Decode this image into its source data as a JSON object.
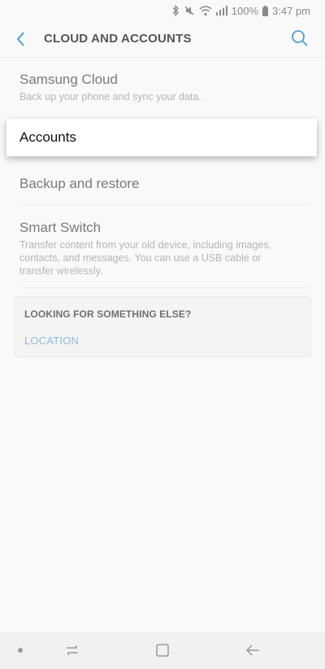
{
  "status_bar": {
    "battery": "100%",
    "time": "3:47 pm",
    "icons": [
      "bluetooth-icon",
      "mute-icon",
      "wifi-icon",
      "signal-icon",
      "battery-icon"
    ]
  },
  "header": {
    "title": "CLOUD AND ACCOUNTS",
    "back_icon": "back-arrow-icon",
    "search_icon": "search-icon",
    "accent_color": "#4a9fd6"
  },
  "items": [
    {
      "title": "Samsung Cloud",
      "subtitle": "Back up your phone and sync your data."
    },
    {
      "title": "Accounts"
    },
    {
      "title": "Backup and restore"
    },
    {
      "title": "Smart Switch",
      "subtitle": "Transfer content from your old device, including images, contacts, and messages. You can use a USB cable or transfer wirelessly."
    }
  ],
  "suggestions": {
    "title": "LOOKING FOR SOMETHING ELSE?",
    "link": "LOCATION",
    "link_color": "#8bbbd6"
  },
  "nav_bar": {
    "icons": [
      "dot-icon",
      "recents-icon",
      "home-icon",
      "back-icon"
    ]
  }
}
